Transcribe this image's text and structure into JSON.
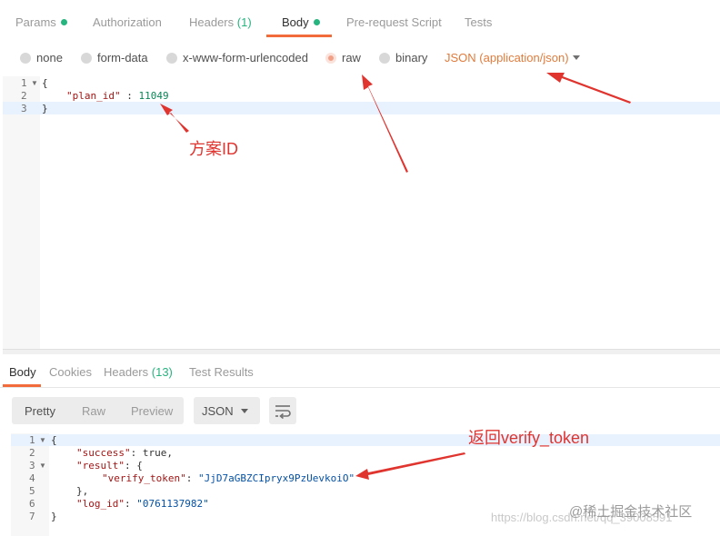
{
  "request_tabs": [
    {
      "label": "Params"
    },
    {
      "label": "Authorization"
    },
    {
      "label": "Headers",
      "count": "(1)"
    },
    {
      "label": "Body"
    },
    {
      "label": "Pre-request Script"
    },
    {
      "label": "Tests"
    }
  ],
  "body_options": [
    "none",
    "form-data",
    "x-www-form-urlencoded",
    "raw",
    "binary"
  ],
  "selected_option": "raw",
  "content_type": "JSON (application/json)",
  "request_code": {
    "line_numbers": [
      "1",
      "2",
      "3"
    ],
    "open": "{",
    "key": "\"plan_id\"",
    "sep": " : ",
    "value": "11049",
    "close": "}"
  },
  "response_tabs": [
    {
      "label": "Body"
    },
    {
      "label": "Cookies"
    },
    {
      "label": "Headers",
      "count": "(13)"
    },
    {
      "label": "Test Results"
    }
  ],
  "view_modes": [
    "Pretty",
    "Raw",
    "Preview"
  ],
  "format": "JSON",
  "response_code": {
    "line_numbers": [
      "1",
      "2",
      "3",
      "4",
      "5",
      "6",
      "7"
    ],
    "l1": "{",
    "l2_key": "\"success\"",
    "l2_rest": ": true,",
    "l3_key": "\"result\"",
    "l3_rest": ": {",
    "l4_key": "\"verify_token\"",
    "l4_sep": ": ",
    "l4_val": "\"JjD7aGBZCIpryx9PzUevkoiO\"",
    "l5": "},",
    "l6_key": "\"log_id\"",
    "l6_sep": ": ",
    "l6_val": "\"0761137982\"",
    "l7": "}"
  },
  "annotations": {
    "plan_id_note": "方案ID",
    "token_note": "返回verify_token"
  },
  "watermark": {
    "url": "https://blog.csdn.net/qq_39008591",
    "brand": "@稀土掘金技术社区"
  },
  "colors": {
    "accent": "#f26b3a",
    "green": "#26b47f",
    "annotation_red": "#e0342f"
  }
}
